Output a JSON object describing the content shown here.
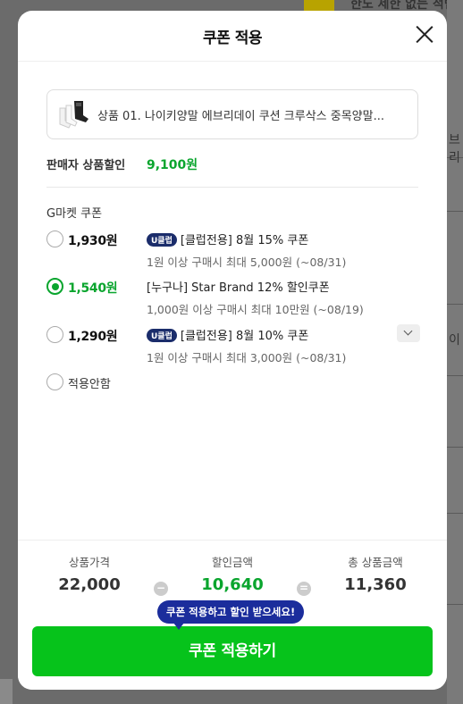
{
  "background": {
    "top_text": "한도 제한 없는 적립",
    "side_text_1": "브리",
    "side_text_2": "이"
  },
  "modal": {
    "title": "쿠폰 적용",
    "close_icon": "close-icon"
  },
  "product": {
    "name": "상품 01. 나이키양말 에브리데이 쿠션 크루삭스 중목양말...",
    "thumb_icon": "socks-image"
  },
  "seller_discount": {
    "label": "판매자 상품할인",
    "amount": "9,100원"
  },
  "coupons": {
    "title": "G마켓 쿠폰",
    "items": [
      {
        "amount": "1,930원",
        "badge": "U클럽",
        "name": "[클럽전용] 8월 15% 쿠폰",
        "desc": "1원 이상 구매시 최대 5,000원 (~08/31)",
        "selected": false
      },
      {
        "amount": "1,540원",
        "badge": "",
        "name": "[누구나] Star Brand 12% 할인쿠폰",
        "desc": "1,000원 이상 구매시 최대 10만원 (~08/19)",
        "selected": true
      },
      {
        "amount": "1,290원",
        "badge": "U클럽",
        "name": "[클럽전용] 8월 10% 쿠폰",
        "desc": "1원 이상 구매시 최대 3,000원 (~08/31)",
        "selected": false
      }
    ],
    "none_label": "적용안함"
  },
  "summary": {
    "price_label": "상품가격",
    "price_value": "22,000",
    "minus_symbol": "−",
    "discount_label": "할인금액",
    "discount_value": "10,640",
    "equals_symbol": "=",
    "total_label": "총 상품금액",
    "total_value": "11,360"
  },
  "tooltip": "쿠폰 적용하고 할인 받으세요!",
  "apply_button": "쿠폰 적용하기",
  "colors": {
    "accent_green": "#06c31b",
    "text_green": "#0aa52e",
    "tooltip_blue": "#1b2d9c",
    "badge_navy": "#1b2d6b"
  }
}
